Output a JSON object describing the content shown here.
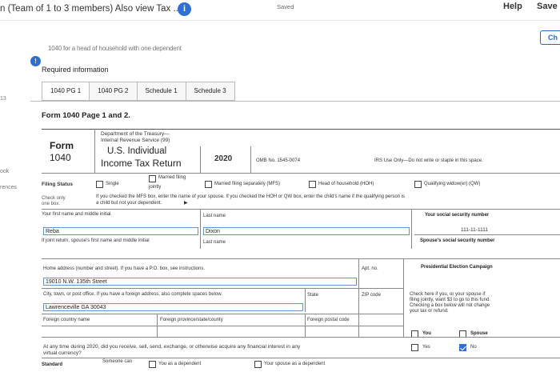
{
  "header": {
    "title": "n (Team of 1 to 3 members) Also view Tax ...",
    "status": "Saved",
    "help": "Help",
    "save": "Save &",
    "check_button": "Ch"
  },
  "side_strip": [
    "ook",
    "rences",
    "13"
  ],
  "assignment": {
    "household_note": "1040 for a head of household with one dependent",
    "required_label": "Required information",
    "tabs": [
      {
        "label": "1040 PG 1"
      },
      {
        "label": "1040 PG 2"
      },
      {
        "label": "Schedule 1"
      },
      {
        "label": "Schedule 3"
      }
    ],
    "panel_title": "Form 1040 Page 1 and 2."
  },
  "form": {
    "form_label": "Form",
    "form_number": "1040",
    "department": "Department of the Treasury—",
    "irs": "Internal Revenue Service (99)",
    "title_line1": "U.S. Individual",
    "title_line2": "Income Tax Return",
    "year": "2020",
    "omb": "OMB No. 1545-0074",
    "irs_use": "IRS Use Only—Do not write or staple in this space.",
    "filing_status_label": "Filing Status",
    "check_only": "Check only",
    "one_box": "one box.",
    "statuses": {
      "single": "Single",
      "mfj_line1": "Married filing",
      "mfj_line2": "jointly",
      "mfs": "Married filing separately (MFS)",
      "hoh": "Head of household (HOH)",
      "qw": "Qualifying widow(er) (QW)"
    },
    "mfs_note": "If you checked the MFS box, enter the name of your spouse. If you checked the HOH or QW box, enter the child's name if the qualifying person is",
    "mfs_note2": "a child but not your dependent.",
    "first_name_label": "Your first name and middle initial",
    "last_name_label": "Last name",
    "ssn_label": "Your social security number",
    "first_name_value": "Reba",
    "last_name_value": "Dixon",
    "ssn_value": "111-11-1111",
    "spouse_label": "If joint return, spouse's first name and middle initial",
    "spouse_last_label": "Last name",
    "spouse_ssn_label": "Spouse's social security number",
    "address_label": "Home address (number and street). If you have a P.O. box, see instructions.",
    "apt_label": "Apt. no.",
    "address_value": "19010 N.W. 135th Street",
    "city_label": "City, town, or post office. If you have a foreign address, also complete spaces below.",
    "state_label": "State",
    "zip_label": "ZIP code",
    "city_value": "Lawrenceville GA 30043",
    "foreign_country_label": "Foreign country name",
    "foreign_province_label": "Foreign province/state/county",
    "foreign_postal_label": "Foreign postal code",
    "pec_title": "Presidential Election Campaign",
    "pec_text": [
      "Check here if you, or your spouse if",
      "filing jointly, want $3 to go to this fund.",
      "Checking a box below will not change",
      "your tax or refund."
    ],
    "you_label": "You",
    "spouse_col_label": "Spouse",
    "virtual_q1": "At any time during 2020, did you receive, sell, send, exchange, or otherwise acquire any financial interest in any",
    "virtual_q2": "virtual currency?",
    "yes_label": "Yes",
    "no_label": "No",
    "standard_label": "Standard",
    "someone_can": "Someone can",
    "you_dependent": "You as a dependent",
    "spouse_dependent": "Your spouse as a dependent"
  }
}
